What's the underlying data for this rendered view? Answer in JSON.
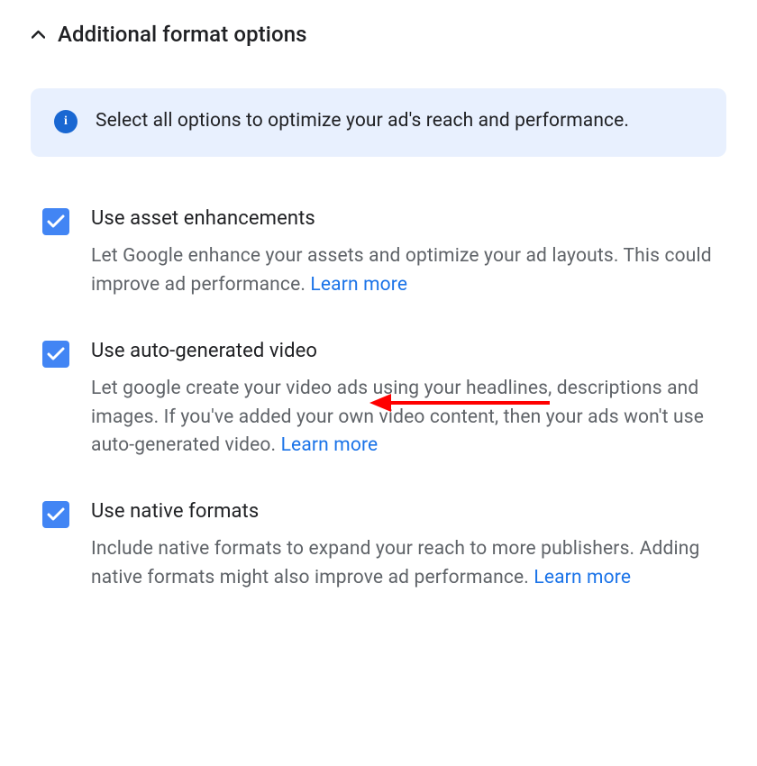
{
  "header": {
    "title": "Additional format options"
  },
  "banner": {
    "text": "Select all options to optimize your ad's reach and performance."
  },
  "options": [
    {
      "title": "Use asset enhancements",
      "description": "Let Google enhance your assets and optimize your ad layouts. This could improve ad performance. ",
      "learn_more": "Learn more"
    },
    {
      "title": "Use auto-generated video",
      "description": "Let google create your video ads using your headlines, descriptions and images. If you've added your own video content, then your ads won't use auto-generated video. ",
      "learn_more": "Learn more"
    },
    {
      "title": "Use native formats",
      "description": "Include native formats to expand your reach to more publishers. Adding native formats might also improve ad performance. ",
      "learn_more": "Learn more"
    }
  ]
}
